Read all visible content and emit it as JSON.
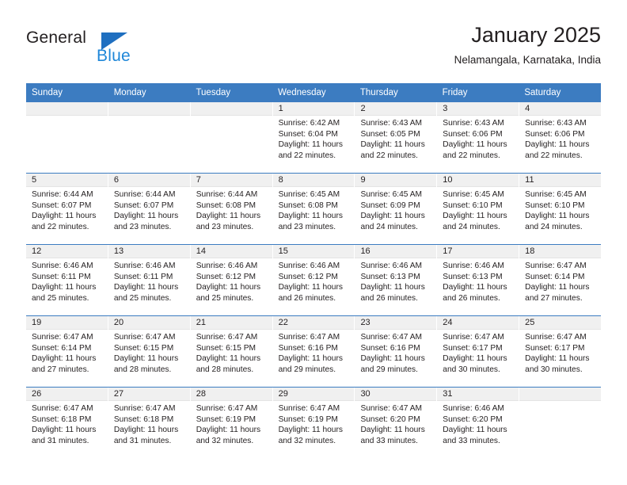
{
  "brand": {
    "name_top": "General",
    "name_bottom": "Blue",
    "accent_color": "#1f87d8",
    "triangle_color": "#1f6fc0",
    "triangle_icon": "triangle-icon"
  },
  "header": {
    "title": "January 2025",
    "subtitle": "Nelamangala, Karnataka, India"
  },
  "calendar": {
    "header_bg": "#3c7cc1",
    "weekdays": [
      "Sunday",
      "Monday",
      "Tuesday",
      "Wednesday",
      "Thursday",
      "Friday",
      "Saturday"
    ],
    "weeks": [
      [
        {
          "day": "",
          "sunrise": "",
          "sunset": "",
          "daylight_line1": "",
          "daylight_line2": "",
          "empty": true
        },
        {
          "day": "",
          "sunrise": "",
          "sunset": "",
          "daylight_line1": "",
          "daylight_line2": "",
          "empty": true
        },
        {
          "day": "",
          "sunrise": "",
          "sunset": "",
          "daylight_line1": "",
          "daylight_line2": "",
          "empty": true
        },
        {
          "day": "1",
          "sunrise": "Sunrise: 6:42 AM",
          "sunset": "Sunset: 6:04 PM",
          "daylight_line1": "Daylight: 11 hours",
          "daylight_line2": "and 22 minutes."
        },
        {
          "day": "2",
          "sunrise": "Sunrise: 6:43 AM",
          "sunset": "Sunset: 6:05 PM",
          "daylight_line1": "Daylight: 11 hours",
          "daylight_line2": "and 22 minutes."
        },
        {
          "day": "3",
          "sunrise": "Sunrise: 6:43 AM",
          "sunset": "Sunset: 6:06 PM",
          "daylight_line1": "Daylight: 11 hours",
          "daylight_line2": "and 22 minutes."
        },
        {
          "day": "4",
          "sunrise": "Sunrise: 6:43 AM",
          "sunset": "Sunset: 6:06 PM",
          "daylight_line1": "Daylight: 11 hours",
          "daylight_line2": "and 22 minutes."
        }
      ],
      [
        {
          "day": "5",
          "sunrise": "Sunrise: 6:44 AM",
          "sunset": "Sunset: 6:07 PM",
          "daylight_line1": "Daylight: 11 hours",
          "daylight_line2": "and 22 minutes."
        },
        {
          "day": "6",
          "sunrise": "Sunrise: 6:44 AM",
          "sunset": "Sunset: 6:07 PM",
          "daylight_line1": "Daylight: 11 hours",
          "daylight_line2": "and 23 minutes."
        },
        {
          "day": "7",
          "sunrise": "Sunrise: 6:44 AM",
          "sunset": "Sunset: 6:08 PM",
          "daylight_line1": "Daylight: 11 hours",
          "daylight_line2": "and 23 minutes."
        },
        {
          "day": "8",
          "sunrise": "Sunrise: 6:45 AM",
          "sunset": "Sunset: 6:08 PM",
          "daylight_line1": "Daylight: 11 hours",
          "daylight_line2": "and 23 minutes."
        },
        {
          "day": "9",
          "sunrise": "Sunrise: 6:45 AM",
          "sunset": "Sunset: 6:09 PM",
          "daylight_line1": "Daylight: 11 hours",
          "daylight_line2": "and 24 minutes."
        },
        {
          "day": "10",
          "sunrise": "Sunrise: 6:45 AM",
          "sunset": "Sunset: 6:10 PM",
          "daylight_line1": "Daylight: 11 hours",
          "daylight_line2": "and 24 minutes."
        },
        {
          "day": "11",
          "sunrise": "Sunrise: 6:45 AM",
          "sunset": "Sunset: 6:10 PM",
          "daylight_line1": "Daylight: 11 hours",
          "daylight_line2": "and 24 minutes."
        }
      ],
      [
        {
          "day": "12",
          "sunrise": "Sunrise: 6:46 AM",
          "sunset": "Sunset: 6:11 PM",
          "daylight_line1": "Daylight: 11 hours",
          "daylight_line2": "and 25 minutes."
        },
        {
          "day": "13",
          "sunrise": "Sunrise: 6:46 AM",
          "sunset": "Sunset: 6:11 PM",
          "daylight_line1": "Daylight: 11 hours",
          "daylight_line2": "and 25 minutes."
        },
        {
          "day": "14",
          "sunrise": "Sunrise: 6:46 AM",
          "sunset": "Sunset: 6:12 PM",
          "daylight_line1": "Daylight: 11 hours",
          "daylight_line2": "and 25 minutes."
        },
        {
          "day": "15",
          "sunrise": "Sunrise: 6:46 AM",
          "sunset": "Sunset: 6:12 PM",
          "daylight_line1": "Daylight: 11 hours",
          "daylight_line2": "and 26 minutes."
        },
        {
          "day": "16",
          "sunrise": "Sunrise: 6:46 AM",
          "sunset": "Sunset: 6:13 PM",
          "daylight_line1": "Daylight: 11 hours",
          "daylight_line2": "and 26 minutes."
        },
        {
          "day": "17",
          "sunrise": "Sunrise: 6:46 AM",
          "sunset": "Sunset: 6:13 PM",
          "daylight_line1": "Daylight: 11 hours",
          "daylight_line2": "and 26 minutes."
        },
        {
          "day": "18",
          "sunrise": "Sunrise: 6:47 AM",
          "sunset": "Sunset: 6:14 PM",
          "daylight_line1": "Daylight: 11 hours",
          "daylight_line2": "and 27 minutes."
        }
      ],
      [
        {
          "day": "19",
          "sunrise": "Sunrise: 6:47 AM",
          "sunset": "Sunset: 6:14 PM",
          "daylight_line1": "Daylight: 11 hours",
          "daylight_line2": "and 27 minutes."
        },
        {
          "day": "20",
          "sunrise": "Sunrise: 6:47 AM",
          "sunset": "Sunset: 6:15 PM",
          "daylight_line1": "Daylight: 11 hours",
          "daylight_line2": "and 28 minutes."
        },
        {
          "day": "21",
          "sunrise": "Sunrise: 6:47 AM",
          "sunset": "Sunset: 6:15 PM",
          "daylight_line1": "Daylight: 11 hours",
          "daylight_line2": "and 28 minutes."
        },
        {
          "day": "22",
          "sunrise": "Sunrise: 6:47 AM",
          "sunset": "Sunset: 6:16 PM",
          "daylight_line1": "Daylight: 11 hours",
          "daylight_line2": "and 29 minutes."
        },
        {
          "day": "23",
          "sunrise": "Sunrise: 6:47 AM",
          "sunset": "Sunset: 6:16 PM",
          "daylight_line1": "Daylight: 11 hours",
          "daylight_line2": "and 29 minutes."
        },
        {
          "day": "24",
          "sunrise": "Sunrise: 6:47 AM",
          "sunset": "Sunset: 6:17 PM",
          "daylight_line1": "Daylight: 11 hours",
          "daylight_line2": "and 30 minutes."
        },
        {
          "day": "25",
          "sunrise": "Sunrise: 6:47 AM",
          "sunset": "Sunset: 6:17 PM",
          "daylight_line1": "Daylight: 11 hours",
          "daylight_line2": "and 30 minutes."
        }
      ],
      [
        {
          "day": "26",
          "sunrise": "Sunrise: 6:47 AM",
          "sunset": "Sunset: 6:18 PM",
          "daylight_line1": "Daylight: 11 hours",
          "daylight_line2": "and 31 minutes."
        },
        {
          "day": "27",
          "sunrise": "Sunrise: 6:47 AM",
          "sunset": "Sunset: 6:18 PM",
          "daylight_line1": "Daylight: 11 hours",
          "daylight_line2": "and 31 minutes."
        },
        {
          "day": "28",
          "sunrise": "Sunrise: 6:47 AM",
          "sunset": "Sunset: 6:19 PM",
          "daylight_line1": "Daylight: 11 hours",
          "daylight_line2": "and 32 minutes."
        },
        {
          "day": "29",
          "sunrise": "Sunrise: 6:47 AM",
          "sunset": "Sunset: 6:19 PM",
          "daylight_line1": "Daylight: 11 hours",
          "daylight_line2": "and 32 minutes."
        },
        {
          "day": "30",
          "sunrise": "Sunrise: 6:47 AM",
          "sunset": "Sunset: 6:20 PM",
          "daylight_line1": "Daylight: 11 hours",
          "daylight_line2": "and 33 minutes."
        },
        {
          "day": "31",
          "sunrise": "Sunrise: 6:46 AM",
          "sunset": "Sunset: 6:20 PM",
          "daylight_line1": "Daylight: 11 hours",
          "daylight_line2": "and 33 minutes."
        },
        {
          "day": "",
          "sunrise": "",
          "sunset": "",
          "daylight_line1": "",
          "daylight_line2": "",
          "empty": true
        }
      ]
    ]
  }
}
